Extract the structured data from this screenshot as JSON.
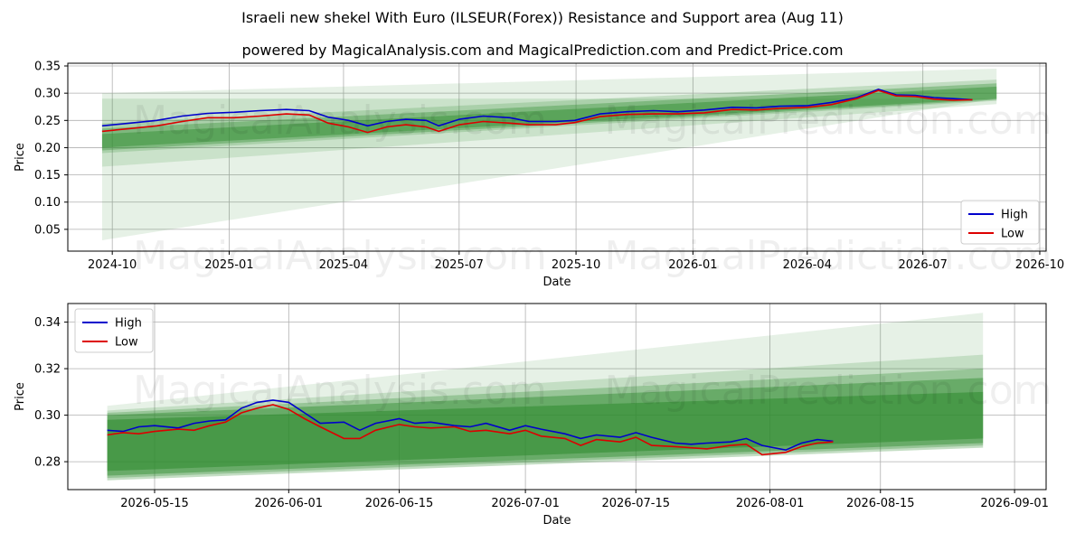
{
  "title": "Israeli new shekel With Euro (ILSEUR(Forex)) Resistance and Support area (Aug 11)",
  "subtitle": "powered by MagicalAnalysis.com and MagicalPrediction.com and Predict-Price.com",
  "watermarks": [
    "MagicalAnalysis.com",
    "MagicalPrediction.com"
  ],
  "colors": {
    "high": "#0000cc",
    "low": "#dd0000",
    "band": "#2e8b2e",
    "grid": "#b0b0b0"
  },
  "chart_data": [
    {
      "type": "line",
      "xlabel": "Date",
      "ylabel": "Price",
      "grid": true,
      "legend": "lower-right",
      "xlim": [
        "2024-08-27",
        "2026-10-06"
      ],
      "ylim": [
        0.01,
        0.355
      ],
      "x_ticks": [
        {
          "date": "2024-10-01",
          "label": "2024-10"
        },
        {
          "date": "2025-01-01",
          "label": "2025-01"
        },
        {
          "date": "2025-04-01",
          "label": "2025-04"
        },
        {
          "date": "2025-07-01",
          "label": "2025-07"
        },
        {
          "date": "2025-10-01",
          "label": "2025-10"
        },
        {
          "date": "2026-01-01",
          "label": "2026-01"
        },
        {
          "date": "2026-04-01",
          "label": "2026-04"
        },
        {
          "date": "2026-07-01",
          "label": "2026-07"
        },
        {
          "date": "2026-10-01",
          "label": "2026-10"
        }
      ],
      "y_ticks": [
        {
          "value": 0.05,
          "label": "0.05"
        },
        {
          "value": 0.1,
          "label": "0.10"
        },
        {
          "value": 0.15,
          "label": "0.15"
        },
        {
          "value": 0.2,
          "label": "0.20"
        },
        {
          "value": 0.25,
          "label": "0.25"
        },
        {
          "value": 0.3,
          "label": "0.30"
        },
        {
          "value": 0.35,
          "label": "0.35"
        }
      ],
      "bands": [
        {
          "x0": "2024-09-23",
          "x1": "2026-08-28",
          "y0": [
            0.03,
            0.3
          ],
          "y1": [
            0.345,
            0.29
          ],
          "opacity": 0.12
        },
        {
          "x0": "2024-09-23",
          "x1": "2026-08-28",
          "y0": [
            0.165,
            0.29
          ],
          "y1": [
            0.28,
            0.29
          ],
          "opacity": 0.15
        },
        {
          "x0": "2024-09-23",
          "x1": "2026-08-28",
          "y0": [
            0.19,
            0.245
          ],
          "y1": [
            0.325,
            0.286
          ],
          "opacity": 0.2
        },
        {
          "x0": "2024-09-23",
          "x1": "2026-08-28",
          "y0": [
            0.195,
            0.235
          ],
          "y1": [
            0.318,
            0.288
          ],
          "opacity": 0.35
        },
        {
          "x0": "2024-09-23",
          "x1": "2026-08-28",
          "y0": [
            0.2,
            0.225
          ],
          "y1": [
            0.312,
            0.29
          ],
          "opacity": 0.45
        }
      ],
      "series": [
        {
          "name": "High",
          "x": [
            "2024-09-23",
            "2024-10-15",
            "2024-11-05",
            "2024-11-25",
            "2024-12-15",
            "2025-01-05",
            "2025-01-25",
            "2025-02-15",
            "2025-03-05",
            "2025-03-20",
            "2025-04-05",
            "2025-04-20",
            "2025-05-05",
            "2025-05-20",
            "2025-06-05",
            "2025-06-15",
            "2025-07-01",
            "2025-07-20",
            "2025-08-10",
            "2025-08-25",
            "2025-09-15",
            "2025-09-30",
            "2025-10-20",
            "2025-11-10",
            "2025-12-01",
            "2025-12-20",
            "2026-01-10",
            "2026-02-01",
            "2026-02-20",
            "2026-03-10",
            "2026-04-01",
            "2026-04-20",
            "2026-05-10",
            "2026-05-27",
            "2026-06-10",
            "2026-06-25",
            "2026-07-10",
            "2026-07-25",
            "2026-08-09"
          ],
          "values": [
            0.24,
            0.245,
            0.25,
            0.258,
            0.263,
            0.265,
            0.268,
            0.27,
            0.268,
            0.256,
            0.25,
            0.24,
            0.248,
            0.252,
            0.25,
            0.24,
            0.252,
            0.258,
            0.255,
            0.248,
            0.248,
            0.25,
            0.262,
            0.266,
            0.268,
            0.266,
            0.269,
            0.274,
            0.273,
            0.276,
            0.277,
            0.283,
            0.292,
            0.307,
            0.297,
            0.296,
            0.292,
            0.29,
            0.288
          ]
        },
        {
          "name": "Low",
          "x": [
            "2024-09-23",
            "2024-10-15",
            "2024-11-05",
            "2024-11-25",
            "2024-12-15",
            "2025-01-05",
            "2025-01-25",
            "2025-02-15",
            "2025-03-05",
            "2025-03-20",
            "2025-04-05",
            "2025-04-20",
            "2025-05-05",
            "2025-05-20",
            "2025-06-05",
            "2025-06-15",
            "2025-07-01",
            "2025-07-20",
            "2025-08-10",
            "2025-08-25",
            "2025-09-15",
            "2025-09-30",
            "2025-10-20",
            "2025-11-10",
            "2025-12-01",
            "2025-12-20",
            "2026-01-10",
            "2026-02-01",
            "2026-02-20",
            "2026-03-10",
            "2026-04-01",
            "2026-04-20",
            "2026-05-10",
            "2026-05-27",
            "2026-06-10",
            "2026-06-25",
            "2026-07-10",
            "2026-07-25",
            "2026-08-09"
          ],
          "values": [
            0.23,
            0.235,
            0.24,
            0.248,
            0.255,
            0.255,
            0.258,
            0.262,
            0.26,
            0.245,
            0.238,
            0.228,
            0.238,
            0.242,
            0.238,
            0.23,
            0.242,
            0.248,
            0.245,
            0.242,
            0.242,
            0.246,
            0.257,
            0.261,
            0.262,
            0.262,
            0.264,
            0.27,
            0.269,
            0.272,
            0.274,
            0.279,
            0.29,
            0.305,
            0.295,
            0.294,
            0.289,
            0.287,
            0.288
          ]
        }
      ]
    },
    {
      "type": "line",
      "xlabel": "Date",
      "ylabel": "Price",
      "grid": true,
      "legend": "upper-left",
      "xlim": [
        "2026-05-04",
        "2026-09-05"
      ],
      "ylim": [
        0.268,
        0.348
      ],
      "x_ticks": [
        {
          "date": "2026-05-15",
          "label": "2026-05-15"
        },
        {
          "date": "2026-06-01",
          "label": "2026-06-01"
        },
        {
          "date": "2026-06-15",
          "label": "2026-06-15"
        },
        {
          "date": "2026-07-01",
          "label": "2026-07-01"
        },
        {
          "date": "2026-07-15",
          "label": "2026-07-15"
        },
        {
          "date": "2026-08-01",
          "label": "2026-08-01"
        },
        {
          "date": "2026-08-15",
          "label": "2026-08-15"
        },
        {
          "date": "2026-09-01",
          "label": "2026-09-01"
        }
      ],
      "y_ticks": [
        {
          "value": 0.28,
          "label": "0.28"
        },
        {
          "value": 0.3,
          "label": "0.30"
        },
        {
          "value": 0.32,
          "label": "0.32"
        },
        {
          "value": 0.34,
          "label": "0.34"
        }
      ],
      "bands": [
        {
          "x0": "2026-05-09",
          "x1": "2026-08-28",
          "y0": [
            0.272,
            0.304
          ],
          "y1": [
            0.286,
            0.344
          ],
          "opacity": 0.12
        },
        {
          "x0": "2026-05-09",
          "x1": "2026-08-28",
          "y0": [
            0.272,
            0.302
          ],
          "y1": [
            0.286,
            0.326
          ],
          "opacity": 0.18
        },
        {
          "x0": "2026-05-09",
          "x1": "2026-08-28",
          "y0": [
            0.273,
            0.301
          ],
          "y1": [
            0.287,
            0.32
          ],
          "opacity": 0.3
        },
        {
          "x0": "2026-05-09",
          "x1": "2026-08-28",
          "y0": [
            0.274,
            0.3
          ],
          "y1": [
            0.288,
            0.316
          ],
          "opacity": 0.45
        },
        {
          "x0": "2026-05-09",
          "x1": "2026-08-28",
          "y0": [
            0.276,
            0.298
          ],
          "y1": [
            0.29,
            0.31
          ],
          "opacity": 0.55
        }
      ],
      "series": [
        {
          "name": "High",
          "x": [
            "2026-05-09",
            "2026-05-11",
            "2026-05-13",
            "2026-05-15",
            "2026-05-18",
            "2026-05-20",
            "2026-05-22",
            "2026-05-24",
            "2026-05-26",
            "2026-05-28",
            "2026-05-30",
            "2026-06-01",
            "2026-06-03",
            "2026-06-05",
            "2026-06-08",
            "2026-06-10",
            "2026-06-12",
            "2026-06-15",
            "2026-06-17",
            "2026-06-19",
            "2026-06-22",
            "2026-06-24",
            "2026-06-26",
            "2026-06-29",
            "2026-07-01",
            "2026-07-03",
            "2026-07-06",
            "2026-07-08",
            "2026-07-10",
            "2026-07-13",
            "2026-07-15",
            "2026-07-17",
            "2026-07-20",
            "2026-07-22",
            "2026-07-24",
            "2026-07-27",
            "2026-07-29",
            "2026-07-31",
            "2026-08-03",
            "2026-08-05",
            "2026-08-07",
            "2026-08-09"
          ],
          "values": [
            0.2935,
            0.293,
            0.295,
            0.2955,
            0.2945,
            0.2965,
            0.2975,
            0.298,
            0.303,
            0.3055,
            0.3065,
            0.3055,
            0.301,
            0.2965,
            0.297,
            0.2935,
            0.2965,
            0.2985,
            0.2965,
            0.297,
            0.2955,
            0.295,
            0.2965,
            0.2935,
            0.2955,
            0.294,
            0.292,
            0.29,
            0.2915,
            0.2905,
            0.2925,
            0.2905,
            0.288,
            0.2875,
            0.288,
            0.2885,
            0.29,
            0.287,
            0.285,
            0.288,
            0.2895,
            0.2888
          ]
        },
        {
          "name": "Low",
          "x": [
            "2026-05-09",
            "2026-05-11",
            "2026-05-13",
            "2026-05-15",
            "2026-05-18",
            "2026-05-20",
            "2026-05-22",
            "2026-05-24",
            "2026-05-26",
            "2026-05-28",
            "2026-05-30",
            "2026-06-01",
            "2026-06-03",
            "2026-06-05",
            "2026-06-08",
            "2026-06-10",
            "2026-06-12",
            "2026-06-15",
            "2026-06-17",
            "2026-06-19",
            "2026-06-22",
            "2026-06-24",
            "2026-06-26",
            "2026-06-29",
            "2026-07-01",
            "2026-07-03",
            "2026-07-06",
            "2026-07-08",
            "2026-07-10",
            "2026-07-13",
            "2026-07-15",
            "2026-07-17",
            "2026-07-20",
            "2026-07-22",
            "2026-07-24",
            "2026-07-27",
            "2026-07-29",
            "2026-07-31",
            "2026-08-03",
            "2026-08-05",
            "2026-08-07",
            "2026-08-09"
          ],
          "values": [
            0.2915,
            0.2925,
            0.292,
            0.293,
            0.294,
            0.2935,
            0.2955,
            0.297,
            0.301,
            0.303,
            0.3045,
            0.3025,
            0.2985,
            0.295,
            0.29,
            0.29,
            0.2935,
            0.296,
            0.295,
            0.2945,
            0.295,
            0.293,
            0.2935,
            0.292,
            0.2935,
            0.291,
            0.29,
            0.287,
            0.2895,
            0.2885,
            0.2905,
            0.287,
            0.2865,
            0.286,
            0.2855,
            0.287,
            0.2875,
            0.283,
            0.284,
            0.2865,
            0.288,
            0.2885
          ]
        }
      ]
    }
  ]
}
